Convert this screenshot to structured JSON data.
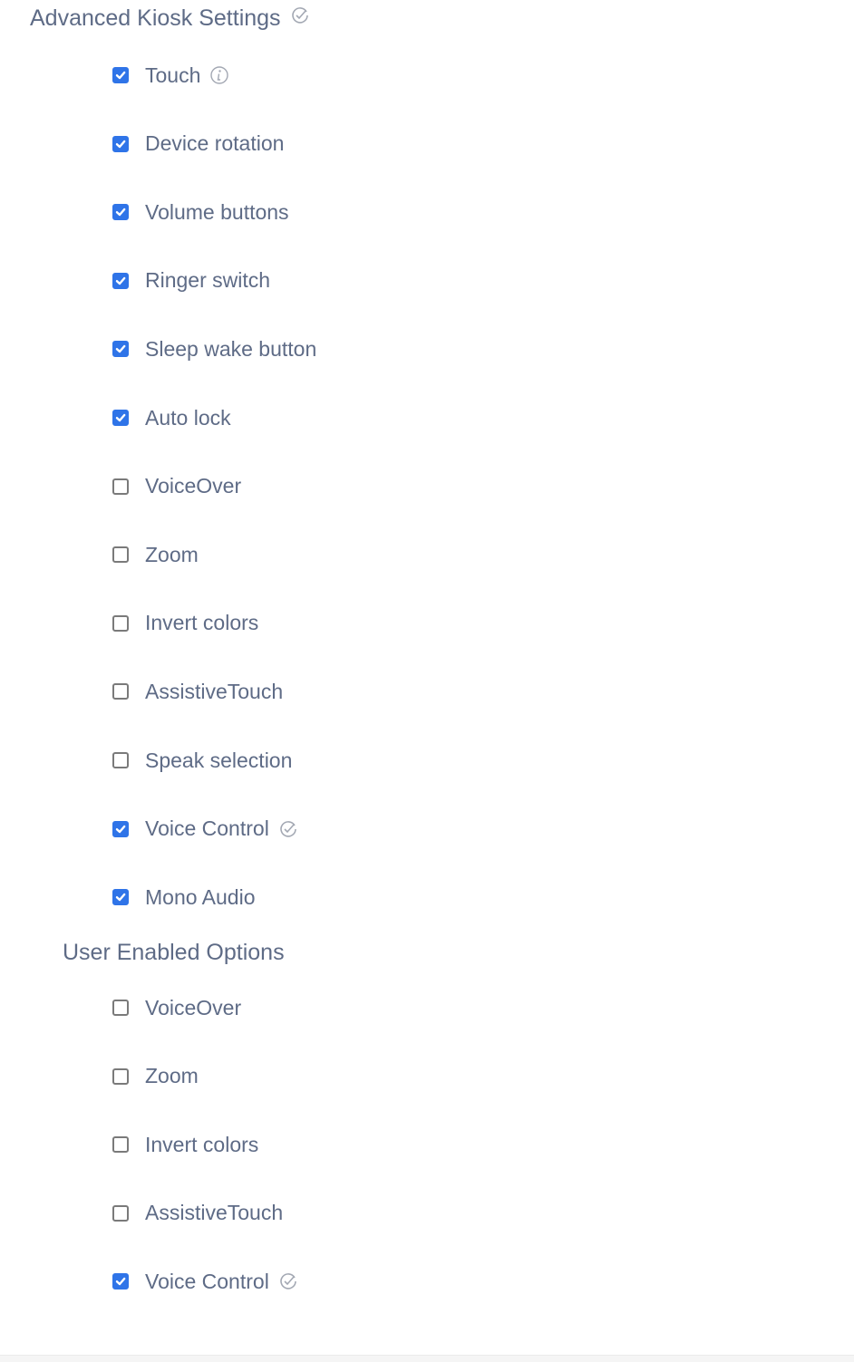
{
  "advanced": {
    "title": "Advanced Kiosk Settings",
    "title_icon": "check-circle-icon",
    "items": [
      {
        "label": "Touch",
        "checked": true,
        "icon": "info-icon"
      },
      {
        "label": "Device rotation",
        "checked": true
      },
      {
        "label": "Volume buttons",
        "checked": true
      },
      {
        "label": "Ringer switch",
        "checked": true
      },
      {
        "label": "Sleep wake button",
        "checked": true
      },
      {
        "label": "Auto lock",
        "checked": true
      },
      {
        "label": "VoiceOver",
        "checked": false
      },
      {
        "label": "Zoom",
        "checked": false
      },
      {
        "label": "Invert colors",
        "checked": false
      },
      {
        "label": "AssistiveTouch",
        "checked": false
      },
      {
        "label": "Speak selection",
        "checked": false
      },
      {
        "label": "Voice Control",
        "checked": true,
        "icon": "check-circle-icon"
      },
      {
        "label": "Mono Audio",
        "checked": true
      }
    ]
  },
  "user_enabled": {
    "title": "User Enabled Options",
    "items": [
      {
        "label": "VoiceOver",
        "checked": false
      },
      {
        "label": "Zoom",
        "checked": false
      },
      {
        "label": "Invert colors",
        "checked": false
      },
      {
        "label": "AssistiveTouch",
        "checked": false
      },
      {
        "label": "Voice Control",
        "checked": true,
        "icon": "check-circle-icon"
      }
    ]
  },
  "colors": {
    "accent": "#2f74e8",
    "text": "#5e6b86",
    "icon": "#a3a8b3"
  }
}
